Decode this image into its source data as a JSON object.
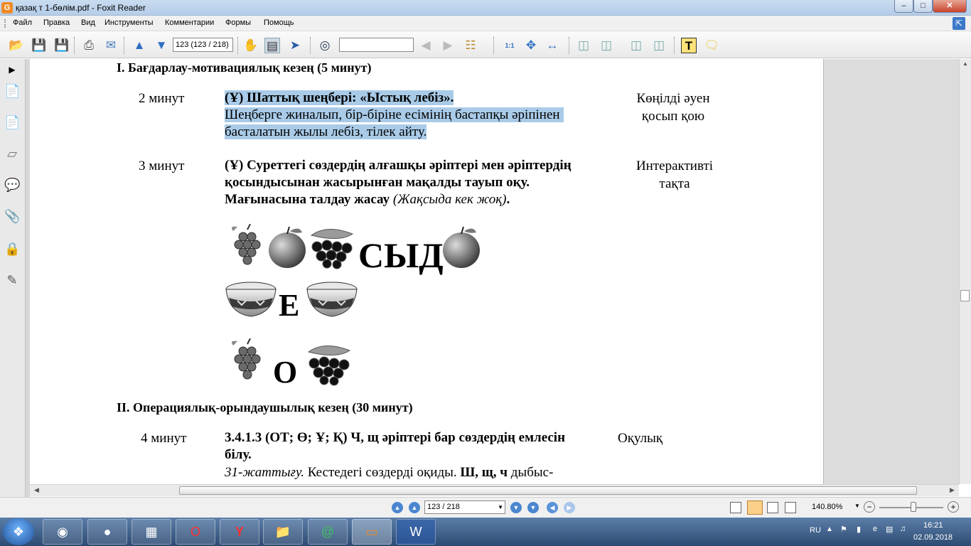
{
  "window": {
    "title": "қазақ т 1-бөлім.pdf - Foxit Reader",
    "app_icon": "foxit-icon",
    "controls": [
      "minimize",
      "maximize",
      "close"
    ]
  },
  "menu": {
    "items": [
      "Файл",
      "Правка",
      "Вид",
      "Инструменты",
      "Комментарии",
      "Формы",
      "Помощь"
    ]
  },
  "toolbar": {
    "page_field": "123 (123 / 218)",
    "search_value": ""
  },
  "document": {
    "section1_heading": "I. Бағдарлау-мотивациялық кезең (5 минут)",
    "row1": {
      "time": "2 минут",
      "title": "(Ұ) Шаттық шеңбері: «Ыстық лебіз».",
      "text_line1": "Шеңберге жиналып, бір-біріне есімінің бастапқы әріпінен",
      "text_line2": "басталатын жылы лебіз, тілек айту.",
      "resource_line1": "Көңілді әуен",
      "resource_line2": "қосып қою"
    },
    "row2": {
      "time": "3 минут",
      "line1": "(Ұ) Суреттегі сөздердің алғашқы әріптері мен әріптердің",
      "line2": "қосындысынан жасырынған мақалды тауып оқу.",
      "line3_bold": "Мағынасына талдау жасау",
      "line3_italic": "(Жақсыда кек жоқ)",
      "line3_end": ".",
      "resource_line1": "Интерактивті",
      "resource_line2": "тақта",
      "puzzle_letters": [
        "СЫД",
        "Е",
        "О"
      ],
      "puzzle_images": [
        "grapes",
        "apple",
        "black-currant",
        "apple",
        "bowl",
        "bowl",
        "grapes",
        "black-currant"
      ]
    },
    "section2_heading": "II. Операциялық-орындаушылық кезең (30 минут)",
    "row3": {
      "time": "4 минут",
      "line1": "3.4.1.3 (ОТ; Ө; Ұ; Қ) Ч, щ әріптері бар сөздердің емлесін",
      "line2": "білу.",
      "line3_italic": "31-жаттығу.",
      "line3_text": " Кестедегі сөздерді оқиды. ",
      "line3_bold": "Ш, щ, ч",
      "line3_end": " дыбыс-",
      "resource": "Оқулық"
    }
  },
  "statusbar": {
    "page": "123 / 218",
    "zoom": "140.80%"
  },
  "taskbar": {
    "language": "RU",
    "time": "16:21",
    "date": "02.09.2018"
  },
  "colors": {
    "selection_highlight": "#a9cbe8",
    "titlebar": "#c9dcf0"
  }
}
